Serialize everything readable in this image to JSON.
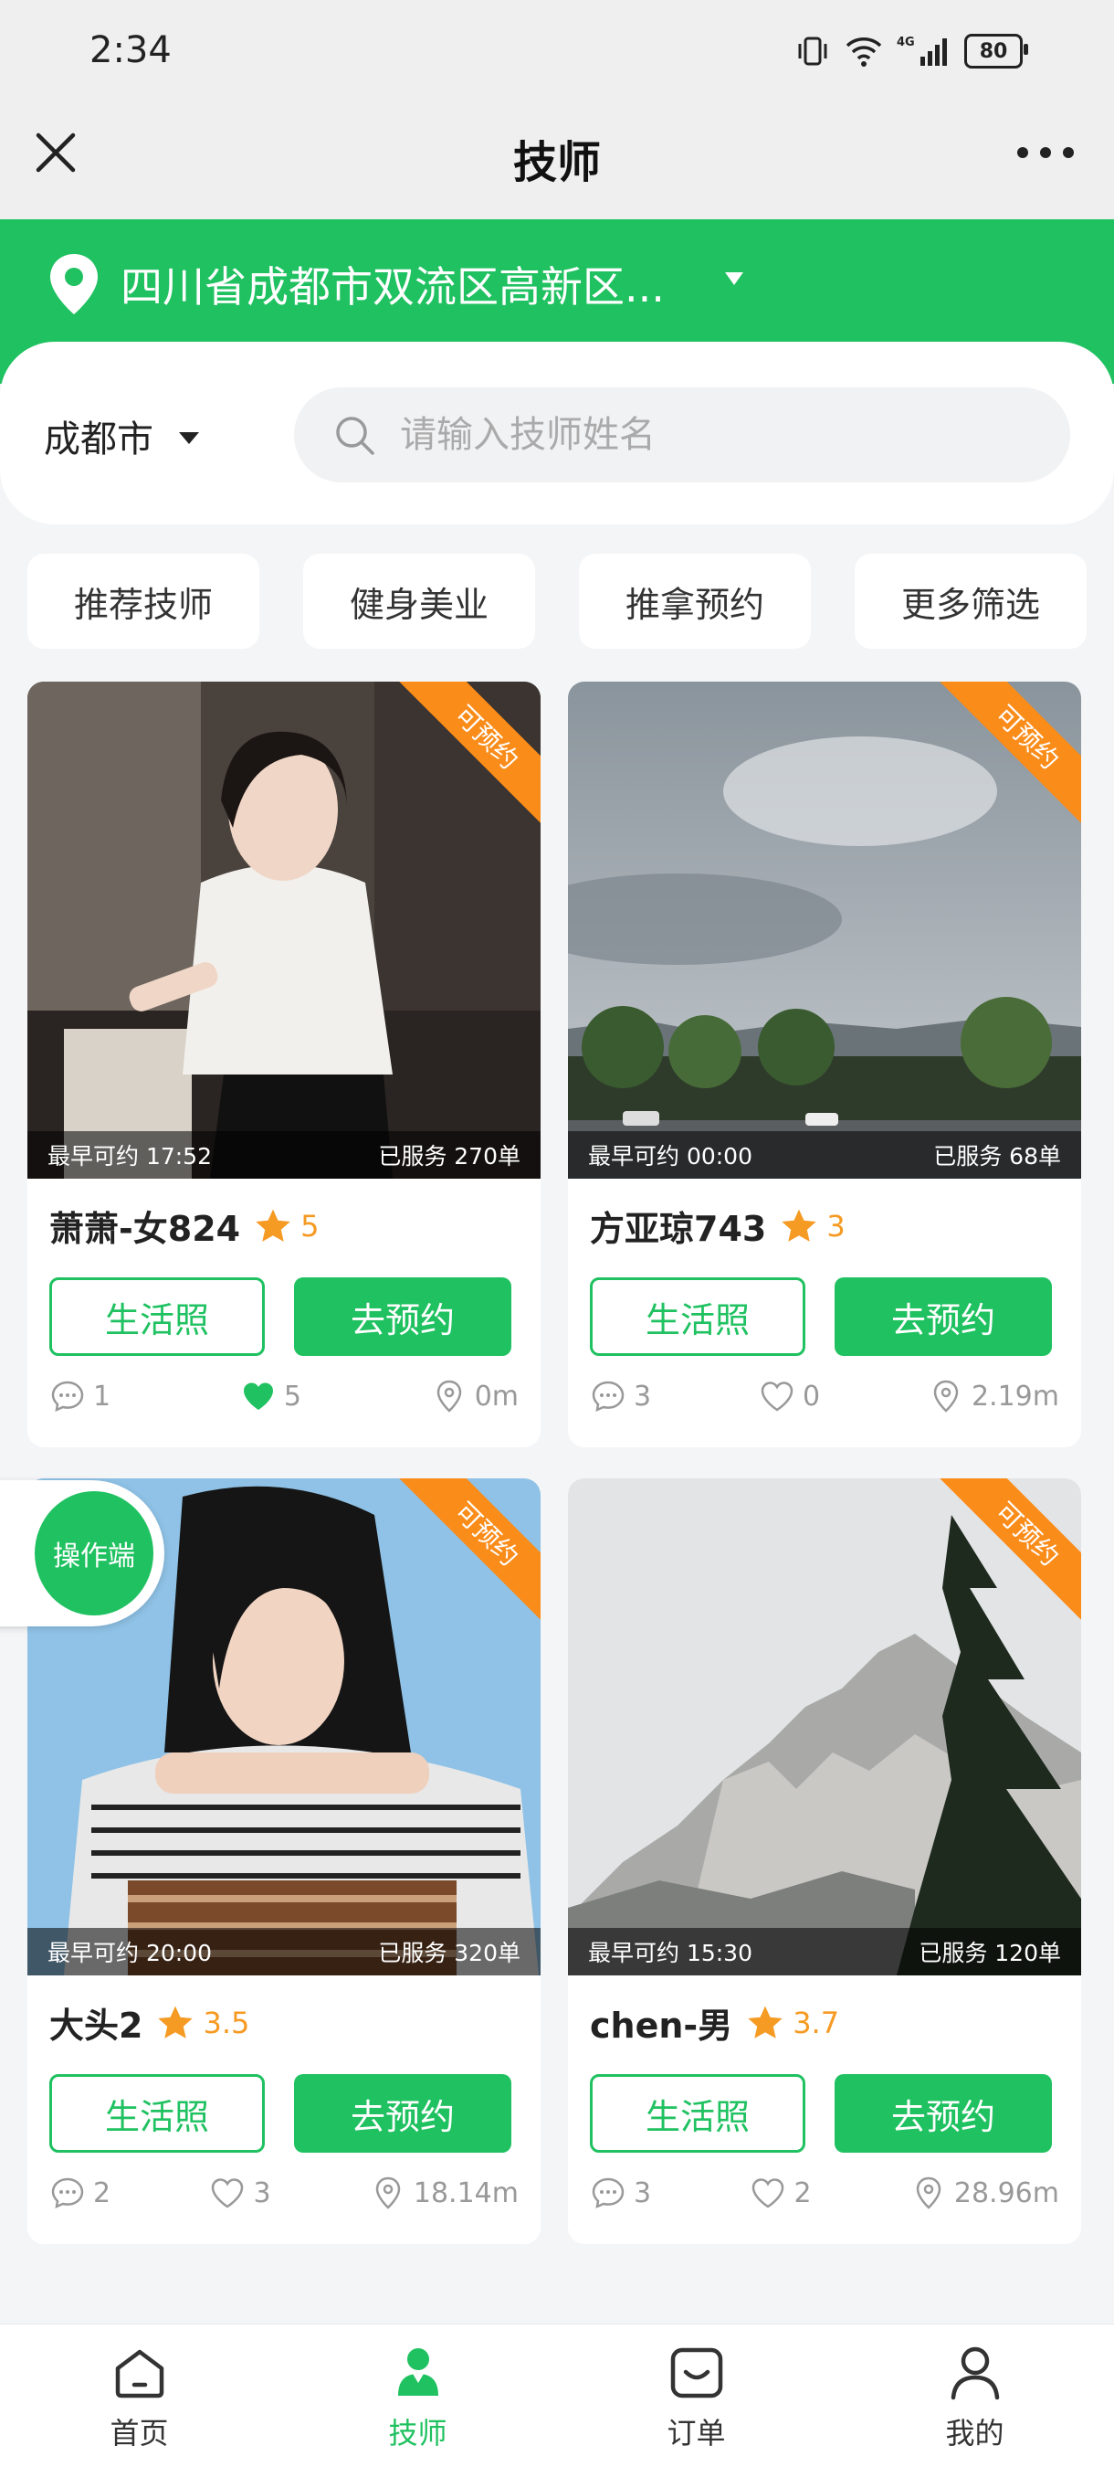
{
  "status_bar": {
    "time": "2:34",
    "battery": "80"
  },
  "navbar": {
    "title": "技师"
  },
  "location": {
    "address": "四川省成都市双流区高新区..."
  },
  "search": {
    "city": "成都市",
    "placeholder": "请输入技师姓名"
  },
  "filters": [
    "推荐技师",
    "健身美业",
    "推拿预约",
    "更多筛选"
  ],
  "cards": [
    {
      "badge": "可预约",
      "earliest": "最早可约 17:52",
      "served": "已服务 270单",
      "name": "萧萧-女824",
      "rating": "5",
      "life_label": "生活照",
      "book_label": "去预约",
      "comments": "1",
      "likes": "5",
      "liked": true,
      "distance": "0m"
    },
    {
      "badge": "可预约",
      "earliest": "最早可约 00:00",
      "served": "已服务 68单",
      "name": "方亚琼743",
      "rating": "3",
      "life_label": "生活照",
      "book_label": "去预约",
      "comments": "3",
      "likes": "0",
      "liked": false,
      "distance": "2.19m"
    },
    {
      "badge": "可预约",
      "earliest": "最早可约 20:00",
      "served": "已服务 320单",
      "name": "大头2",
      "rating": "3.5",
      "life_label": "生活照",
      "book_label": "去预约",
      "comments": "2",
      "likes": "3",
      "liked": false,
      "distance": "18.14m"
    },
    {
      "badge": "可预约",
      "earliest": "最早可约 15:30",
      "served": "已服务 120单",
      "name": "chen-男",
      "rating": "3.7",
      "life_label": "生活照",
      "book_label": "去预约",
      "comments": "3",
      "likes": "2",
      "liked": false,
      "distance": "28.96m"
    }
  ],
  "floating": {
    "label": "操作端"
  },
  "tabbar": [
    {
      "label": "首页",
      "icon": "home-icon"
    },
    {
      "label": "技师",
      "icon": "technician-icon"
    },
    {
      "label": "订单",
      "icon": "order-icon"
    },
    {
      "label": "我的",
      "icon": "profile-icon"
    }
  ],
  "colors": {
    "brand": "#1fc160",
    "badge": "#fa8c1a",
    "rating": "#f59a23"
  }
}
